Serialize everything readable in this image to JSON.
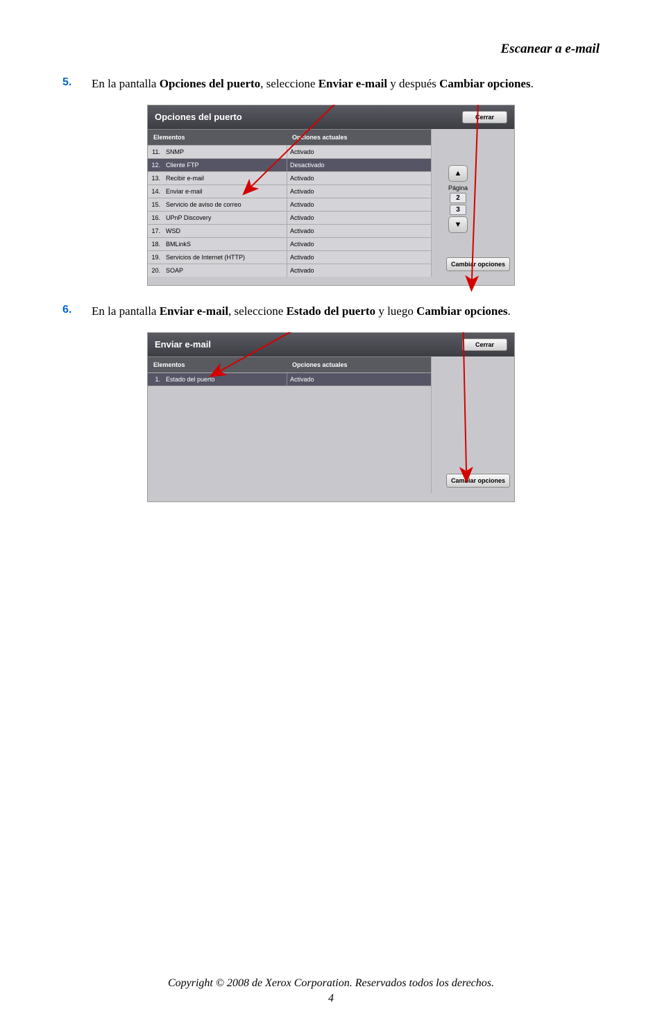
{
  "header": "Escanear a e-mail",
  "step5": {
    "num": "5.",
    "text_pre": "En la pantalla ",
    "b1": "Opciones del puerto",
    "mid1": ", seleccione ",
    "b2": "Enviar e-mail",
    "mid2": " y después ",
    "b3": "Cambiar opciones",
    "tail": "."
  },
  "step6": {
    "num": "6.",
    "text_pre": "En la pantalla ",
    "b1": "Enviar e-mail",
    "mid1": ", seleccione ",
    "b2": "Estado del puerto",
    "mid2": " y luego ",
    "b3": "Cambiar opciones",
    "tail": "."
  },
  "shot1": {
    "title": "Opciones del puerto",
    "cerrar": "Cerrar",
    "h1": "Elementos",
    "h2": "Opciones actuales",
    "rows": [
      {
        "n": "11.",
        "name": "SNMP",
        "val": "Activado",
        "sel": false
      },
      {
        "n": "12.",
        "name": "Cliente FTP",
        "val": "Desactivado",
        "sel": true
      },
      {
        "n": "13.",
        "name": "Recibir e-mail",
        "val": "Activado",
        "sel": false
      },
      {
        "n": "14.",
        "name": "Enviar e-mail",
        "val": "Activado",
        "sel": false
      },
      {
        "n": "15.",
        "name": "Servicio de aviso de correo",
        "val": "Activado",
        "sel": false
      },
      {
        "n": "16.",
        "name": "UPnP Discovery",
        "val": "Activado",
        "sel": false
      },
      {
        "n": "17.",
        "name": "WSD",
        "val": "Activado",
        "sel": false
      },
      {
        "n": "18.",
        "name": "BMLinkS",
        "val": "Activado",
        "sel": false
      },
      {
        "n": "19.",
        "name": "Servicios de Internet (HTTP)",
        "val": "Activado",
        "sel": false
      },
      {
        "n": "20.",
        "name": "SOAP",
        "val": "Activado",
        "sel": false
      }
    ],
    "pagina": "Página",
    "pg2": "2",
    "pg3": "3",
    "cambiar": "Cambiar opciones"
  },
  "shot2": {
    "title": "Enviar e-mail",
    "cerrar": "Cerrar",
    "h1": "Elementos",
    "h2": "Opciones actuales",
    "row": {
      "n": "1.",
      "name": "Estado del puerto",
      "val": "Activado"
    },
    "cambiar": "Cambiar opciones"
  },
  "footer": "Copyright © 2008 de Xerox Corporation. Reservados todos los derechos.",
  "page": "4"
}
